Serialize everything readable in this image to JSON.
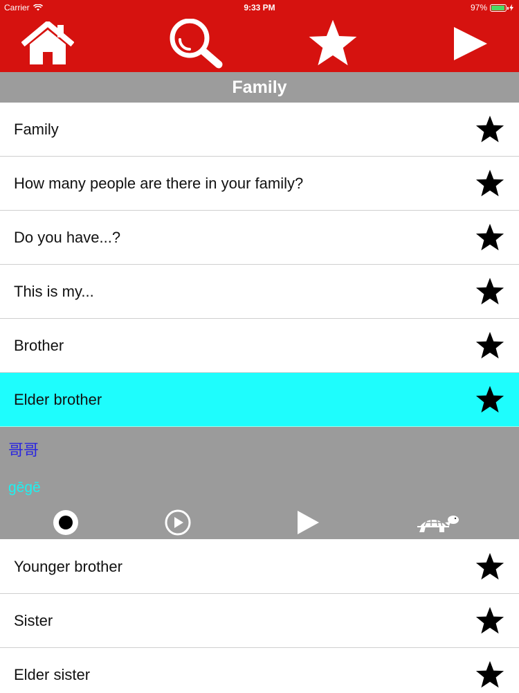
{
  "status_bar": {
    "carrier": "Carrier",
    "time": "9:33 PM",
    "battery": "97%",
    "battery_level": 0.97
  },
  "toolbar": {
    "icons": [
      "home-icon",
      "search-icon",
      "star-icon",
      "play-icon"
    ]
  },
  "section": {
    "title": "Family"
  },
  "rows_top": [
    {
      "label": "Family"
    },
    {
      "label": "How many people are there in your family?"
    },
    {
      "label": "Do you have...?"
    },
    {
      "label": "This is my..."
    },
    {
      "label": "Brother"
    },
    {
      "label": "Elder brother",
      "selected": true
    }
  ],
  "detail": {
    "hanzi": "哥哥",
    "pinyin": "gēgē",
    "controls": [
      "record-icon",
      "play-recording-icon",
      "play-icon",
      "turtle-slow-icon"
    ]
  },
  "rows_bottom": [
    {
      "label": "Younger brother"
    },
    {
      "label": "Sister"
    },
    {
      "label": "Elder sister"
    }
  ],
  "colors": {
    "header_red": "#d6120f",
    "section_gray": "#9c9c9c",
    "selected_cyan": "#1efdfd",
    "hanzi_blue": "#2a25e0",
    "pinyin_cyan": "#1ff0f0"
  }
}
